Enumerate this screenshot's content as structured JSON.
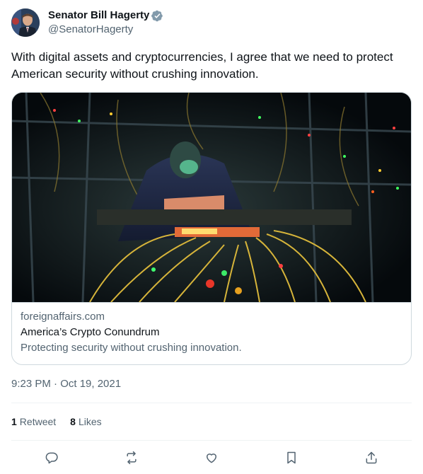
{
  "author": {
    "display_name": "Senator Bill Hagerty",
    "handle": "@SenatorHagerty"
  },
  "tweet": {
    "text": "With digital assets and cryptocurrencies, I agree that we need to protect American security without crushing innovation."
  },
  "card": {
    "domain": "foreignaffairs.com",
    "title": "America’s Crypto Conundrum",
    "description": "Protecting security without crushing innovation."
  },
  "meta": {
    "timestamp": "9:23 PM · Oct 19, 2021"
  },
  "stats": {
    "retweets_count": "1",
    "retweets_label": "Retweet",
    "likes_count": "8",
    "likes_label": "Likes"
  },
  "icons": {
    "verified": "verified-badge-icon",
    "reply": "reply-icon",
    "retweet": "retweet-icon",
    "like": "heart-icon",
    "bookmark": "bookmark-icon",
    "share": "share-icon"
  },
  "colors": {
    "text": "#0f1419",
    "secondary": "#536471",
    "border": "#cfd9de",
    "verified": "#829aab"
  }
}
